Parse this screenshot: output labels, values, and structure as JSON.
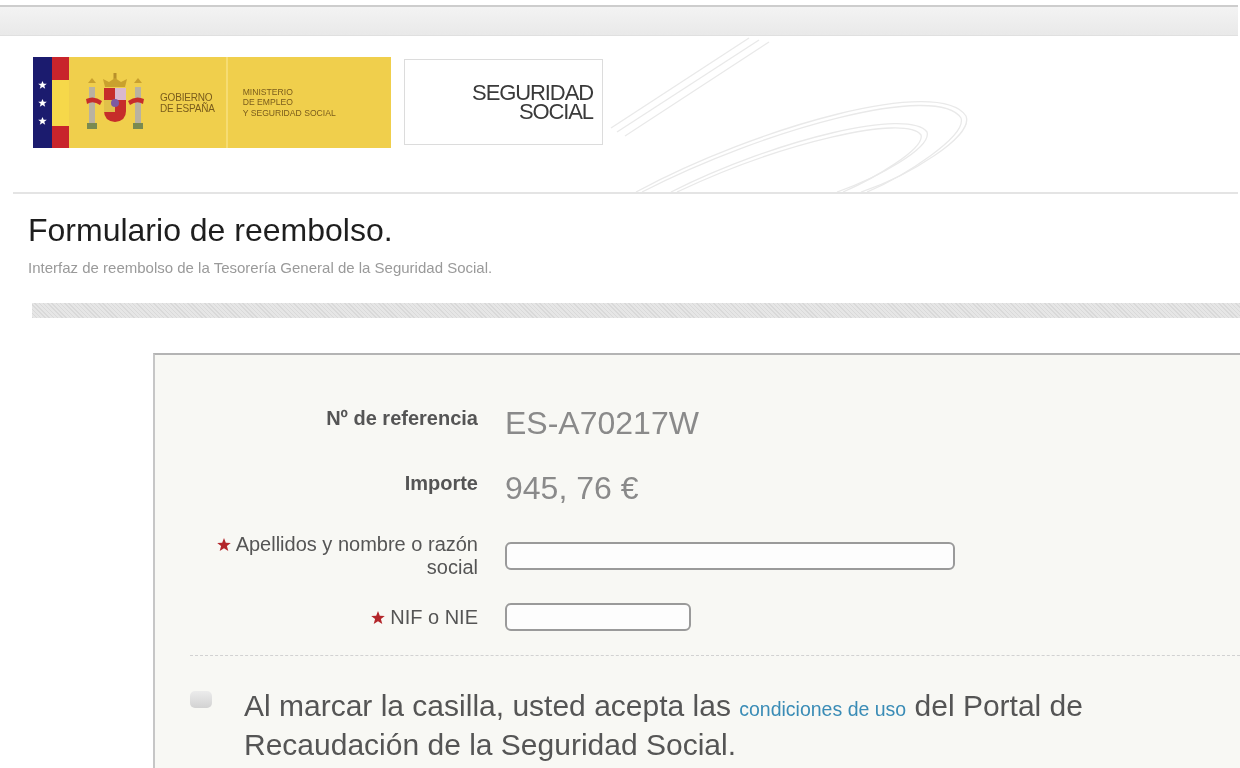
{
  "header": {
    "gov_logo": {
      "government": [
        "GOBIERNO",
        "DE ESPAÑA"
      ],
      "ministry": [
        "MINISTERIO",
        "DE EMPLEO",
        "Y SEGURIDAD SOCIAL"
      ]
    },
    "agency_logo": [
      "SEGURIDAD",
      "SOCIAL"
    ]
  },
  "heading": {
    "title": "Formulario de reembolso.",
    "subtitle": "Interfaz de reembolso de la Tesorería General de la Seguridad Social."
  },
  "form": {
    "fields": [
      {
        "kind": "display",
        "label": "Nº de referencia",
        "value": "ES-A70217W"
      },
      {
        "kind": "display",
        "label": "Importe",
        "value": "945, 76 €"
      },
      {
        "kind": "input",
        "label": "Apellidos y nombre o razón social",
        "required": true
      },
      {
        "kind": "input",
        "label": "NIF o NIE",
        "required": true
      }
    ],
    "consent": {
      "checked": false,
      "text_before": "Al marcar la casilla, usted acepta las",
      "link": "condiciones de uso",
      "text_after": "del Portal de Recaudación de la Seguridad Social."
    }
  }
}
